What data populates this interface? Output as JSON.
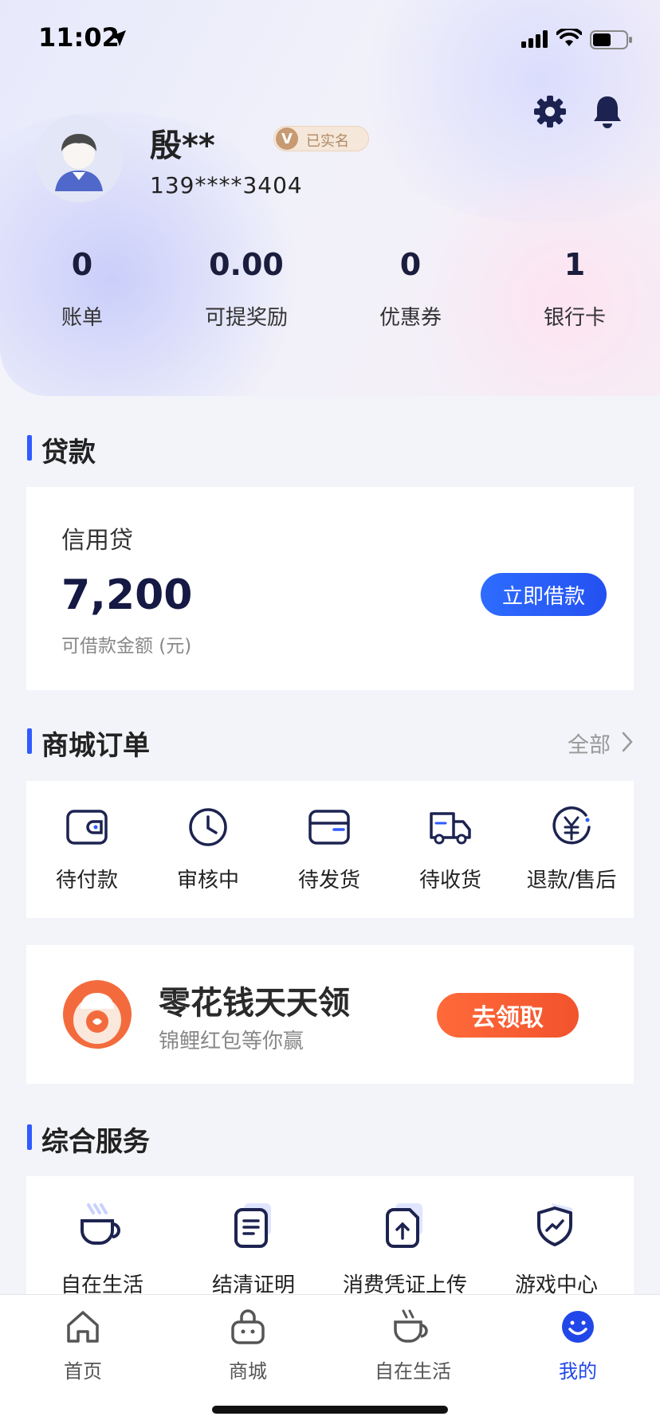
{
  "status_bar": {
    "time": "11:02"
  },
  "profile": {
    "name": "殷**",
    "verified_badge": {
      "letter": "V",
      "text": "已实名"
    },
    "phone": "139****3404"
  },
  "stats": [
    {
      "value": "0",
      "label": "账单"
    },
    {
      "value": "0.00",
      "label": "可提奖励"
    },
    {
      "value": "0",
      "label": "优惠券"
    },
    {
      "value": "1",
      "label": "银行卡"
    }
  ],
  "loan": {
    "section_title": "贷款",
    "product": "信用贷",
    "amount": "7,200",
    "amount_caption": "可借款金额 (元)",
    "button": "立即借款"
  },
  "orders": {
    "section_title": "商城订单",
    "view_all": "全部",
    "items": [
      {
        "label": "待付款",
        "icon": "wallet-icon"
      },
      {
        "label": "审核中",
        "icon": "clock-icon"
      },
      {
        "label": "待发货",
        "icon": "package-icon"
      },
      {
        "label": "待收货",
        "icon": "truck-icon"
      },
      {
        "label": "退款/售后",
        "icon": "yuan-refund-icon"
      }
    ]
  },
  "promo": {
    "title": "零花钱天天领",
    "subtitle": "锦鲤红包等你赢",
    "button": "去领取"
  },
  "services": {
    "section_title": "综合服务",
    "items": [
      {
        "label": "自在生活",
        "icon": "coffee-cup-icon"
      },
      {
        "label": "结清证明",
        "icon": "document-icon"
      },
      {
        "label": "消费凭证上传",
        "icon": "upload-file-icon"
      },
      {
        "label": "游戏中心",
        "icon": "shield-icon"
      }
    ]
  },
  "tabbar": {
    "items": [
      {
        "label": "首页",
        "icon": "home-icon"
      },
      {
        "label": "商城",
        "icon": "shopping-bag-icon"
      },
      {
        "label": "自在生活",
        "icon": "coffee-cup-icon"
      },
      {
        "label": "我的",
        "icon": "smile-icon",
        "active": true
      }
    ]
  },
  "colors": {
    "accent_blue": "#2f5bff",
    "promo_orange": "#f2532d",
    "verified_gold": "#c79a72",
    "text_dark": "#1b1d3d"
  }
}
